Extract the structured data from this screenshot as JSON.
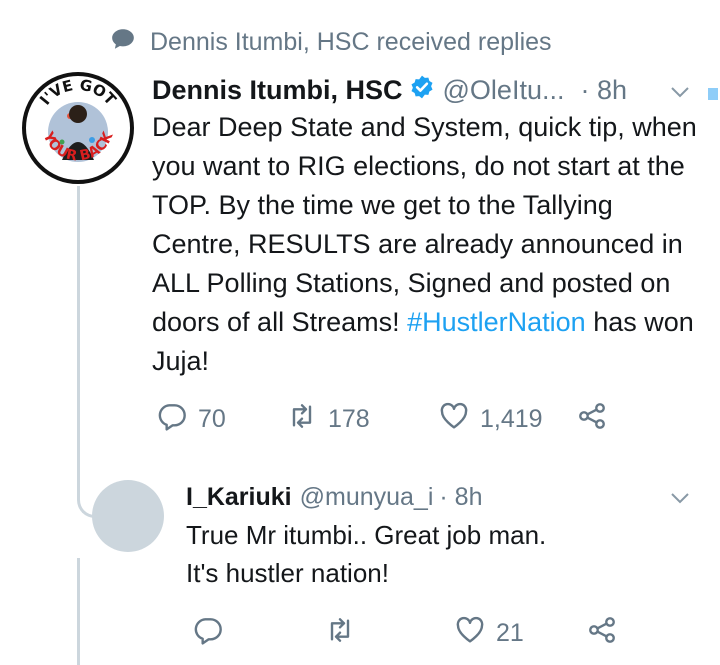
{
  "context_text": "Dennis Itumbi, HSC received replies",
  "tweet": {
    "name": "Dennis Itumbi, HSC",
    "handle": "@OleItu...",
    "time": "· 8h",
    "avatar_text_top": "I'VE GOT",
    "avatar_text_bottom": "YOUR BACK",
    "text_before": "Dear Deep State and System, quick tip, when you want to RIG elections, do not start at the TOP. By the time we get to the Tallying Centre, RESULTS are already announced in ALL Polling Stations, Signed and posted on doors of all Streams! ",
    "hashtag": "#HustlerNation",
    "text_after": " has won Juja!",
    "replies": "70",
    "retweets": "178",
    "likes": "1,419"
  },
  "reply": {
    "name": "I_Kariuki",
    "handle": "@munyua_i",
    "time": "· 8h",
    "line1": "True Mr itumbi.. Great job man.",
    "line2": "It's hustler nation!",
    "likes": "21"
  },
  "colors": {
    "accent": "#1da1f2",
    "muted": "#657786",
    "thread_line": "#ccd6dd",
    "verified": "#1da1f2"
  },
  "icons": [
    "speech-bubble-icon",
    "verified-badge-icon",
    "chevron-down-icon",
    "reply-icon",
    "retweet-icon",
    "like-icon",
    "share-icon"
  ]
}
